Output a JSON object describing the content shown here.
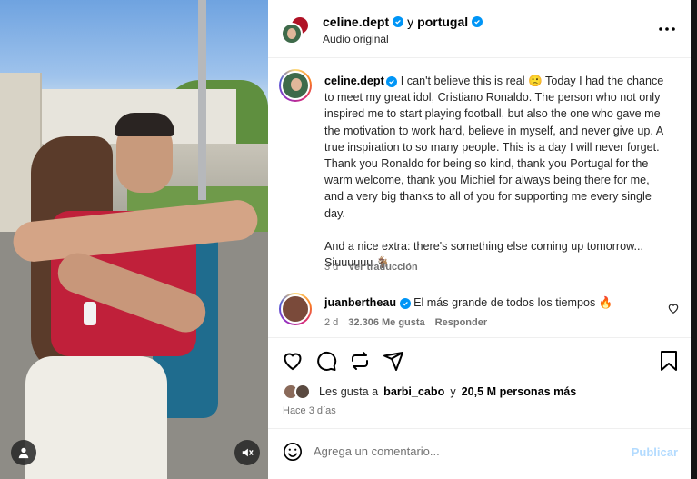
{
  "post": {
    "author": "celine.dept",
    "connector": "y",
    "collaborator": "portugal",
    "audio": "Audio original"
  },
  "caption": {
    "user": "celine.dept",
    "paragraph1": "I can't believe this is real 🙁 Today I had the chance to meet my great idol, Cristiano Ronaldo. The person who not only inspired me to start playing football, but also the one who gave me the motivation to work hard, believe in myself, and never give up. A true inspiration to so many people. This is a day I will never forget. Thank you Ronaldo for being so kind, thank you Portugal for the warm welcome, thank you Michiel for always being there for me, and a very big thanks to all of you for supporting me every single day.",
    "paragraph2": "And a nice extra: there's something else coming up tomorrow... Siuuuuuu 🐐",
    "time": "3 d",
    "translate": "Ver traducción"
  },
  "comment": {
    "user": "juanbertheau",
    "text": "El más grande de todos los tiempos 🔥",
    "time": "2 d",
    "likes": "32.306 Me gusta",
    "reply": "Responder"
  },
  "likes": {
    "prefix": "Les gusta a",
    "user": "barbi_cabo",
    "middle": "y",
    "others": "20,5 M personas más"
  },
  "timestamp": "Hace 3 días",
  "add_comment": {
    "placeholder": "Agrega un comentario...",
    "publish": "Publicar"
  },
  "icons": {
    "more": "more-icon",
    "like": "heart-icon",
    "comment": "comment-icon",
    "share": "repost-icon",
    "send": "send-icon",
    "save": "bookmark-icon",
    "emoji": "emoji-icon",
    "user_tag": "user-tag-icon",
    "mute": "muted-icon"
  },
  "colors": {
    "verified": "#0095f6",
    "link_disabled": "#b3dbff",
    "secondary_text": "#737373"
  }
}
